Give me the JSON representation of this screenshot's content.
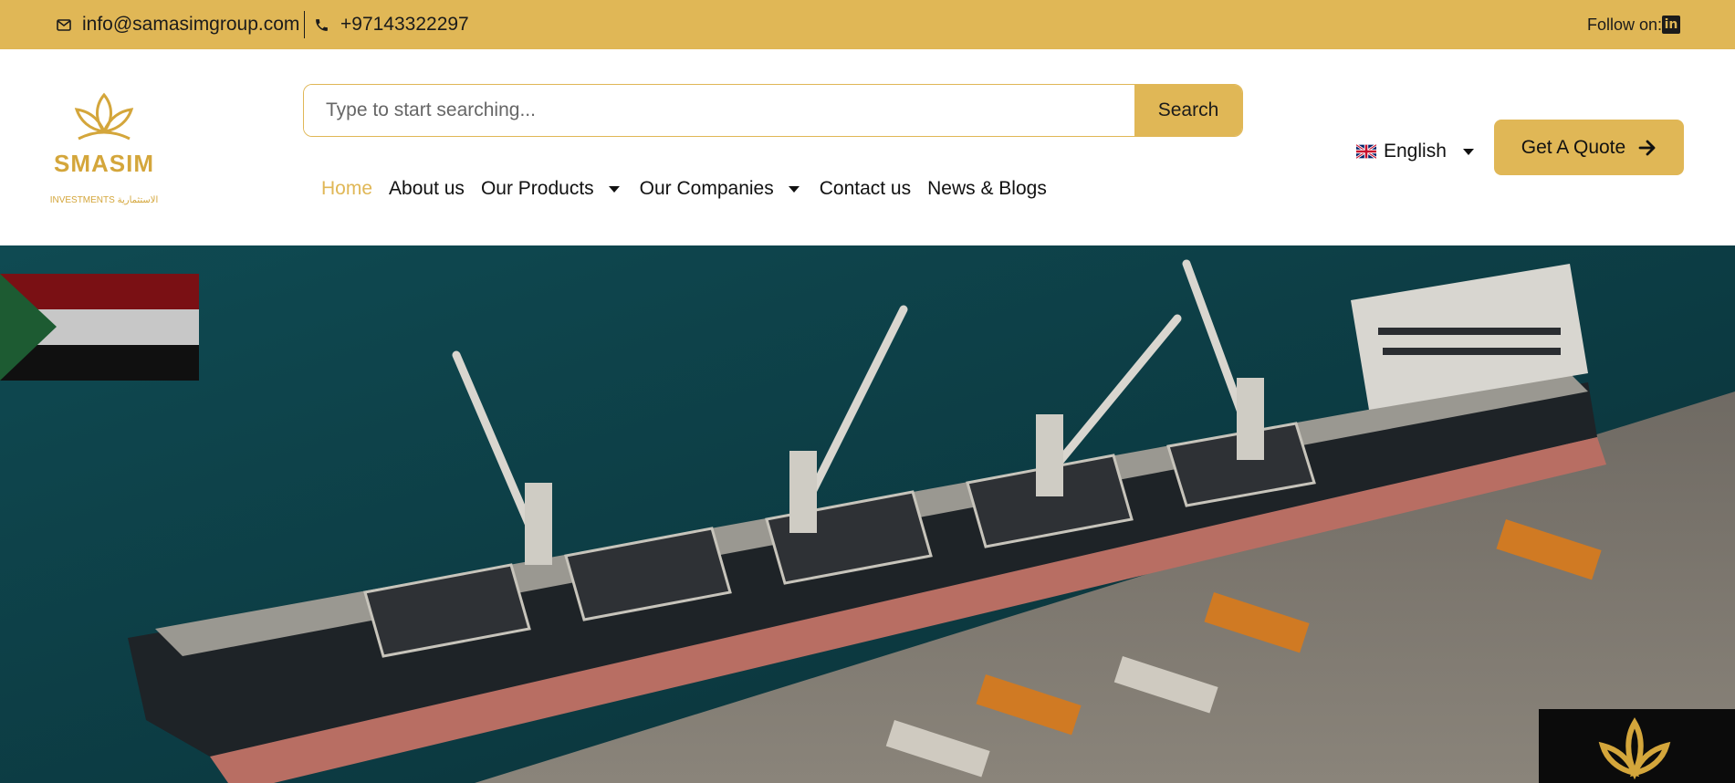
{
  "topbar": {
    "email": "info@samasimgroup.com",
    "phone": "+97143322297",
    "follow_label": "Follow on:",
    "social_icon": "linkedin-icon",
    "linkedin_glyph": "in"
  },
  "logo": {
    "word": "SMASIM",
    "sub": "INVESTMENTS الاستثمارية"
  },
  "search": {
    "placeholder": "Type to start searching...",
    "button_label": "Search"
  },
  "nav": {
    "items": [
      {
        "label": "Home",
        "active": true,
        "dropdown": false
      },
      {
        "label": "About us",
        "active": false,
        "dropdown": false
      },
      {
        "label": "Our Products",
        "active": false,
        "dropdown": true
      },
      {
        "label": "Our Companies",
        "active": false,
        "dropdown": true
      },
      {
        "label": "Contact us",
        "active": false,
        "dropdown": false
      },
      {
        "label": "News & Blogs",
        "active": false,
        "dropdown": false
      }
    ]
  },
  "language": {
    "selected": "English"
  },
  "cta": {
    "label": "Get A Quote"
  },
  "colors": {
    "accent": "#e0b756",
    "text": "#111111",
    "hero_water": "#0d3b44"
  }
}
